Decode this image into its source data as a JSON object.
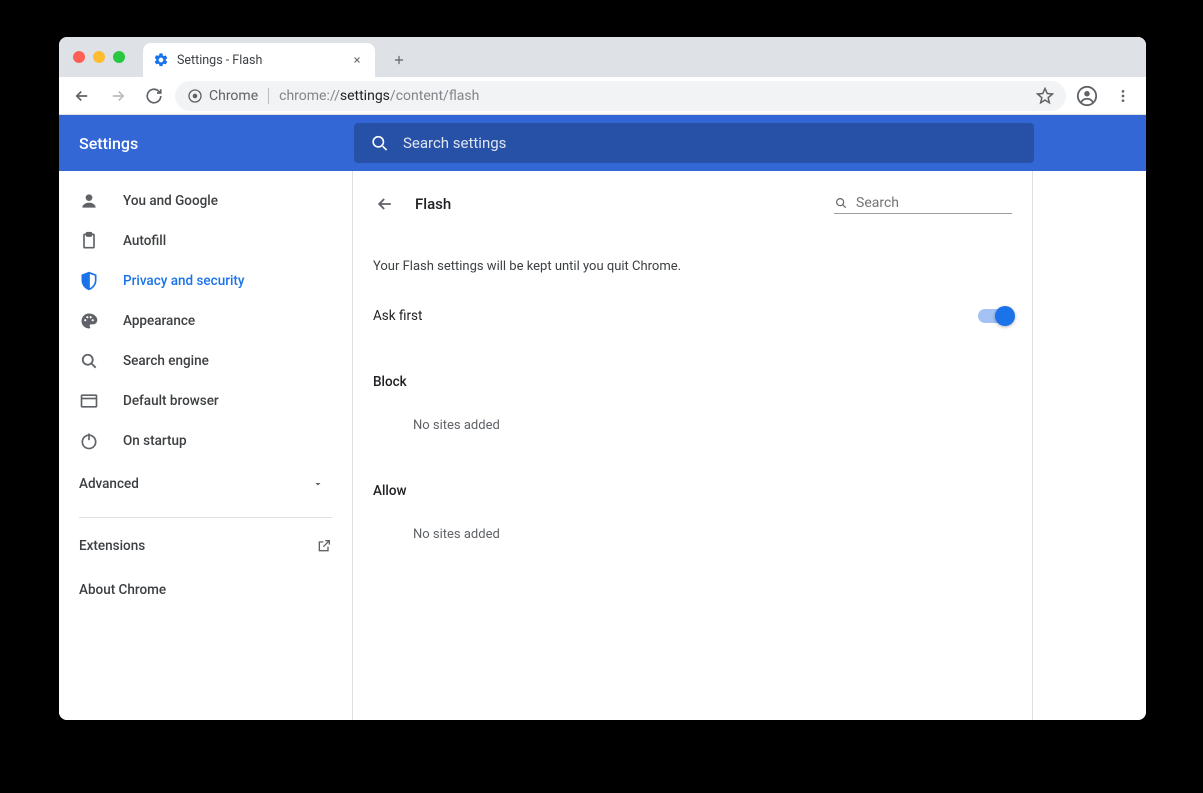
{
  "tab": {
    "title": "Settings - Flash"
  },
  "omnibox": {
    "chip": "Chrome",
    "pre": "chrome://",
    "mid": "settings",
    "post": "/content/flash"
  },
  "header": {
    "title": "Settings",
    "search_placeholder": "Search settings"
  },
  "sidebar": {
    "items": [
      {
        "label": "You and Google"
      },
      {
        "label": "Autofill"
      },
      {
        "label": "Privacy and security"
      },
      {
        "label": "Appearance"
      },
      {
        "label": "Search engine"
      },
      {
        "label": "Default browser"
      },
      {
        "label": "On startup"
      }
    ],
    "advanced": "Advanced",
    "extensions": "Extensions",
    "about": "About Chrome"
  },
  "page": {
    "title": "Flash",
    "search_placeholder": "Search",
    "notice": "Your Flash settings will be kept until you quit Chrome.",
    "toggle_label": "Ask first",
    "block_label": "Block",
    "block_empty": "No sites added",
    "allow_label": "Allow",
    "allow_empty": "No sites added"
  }
}
